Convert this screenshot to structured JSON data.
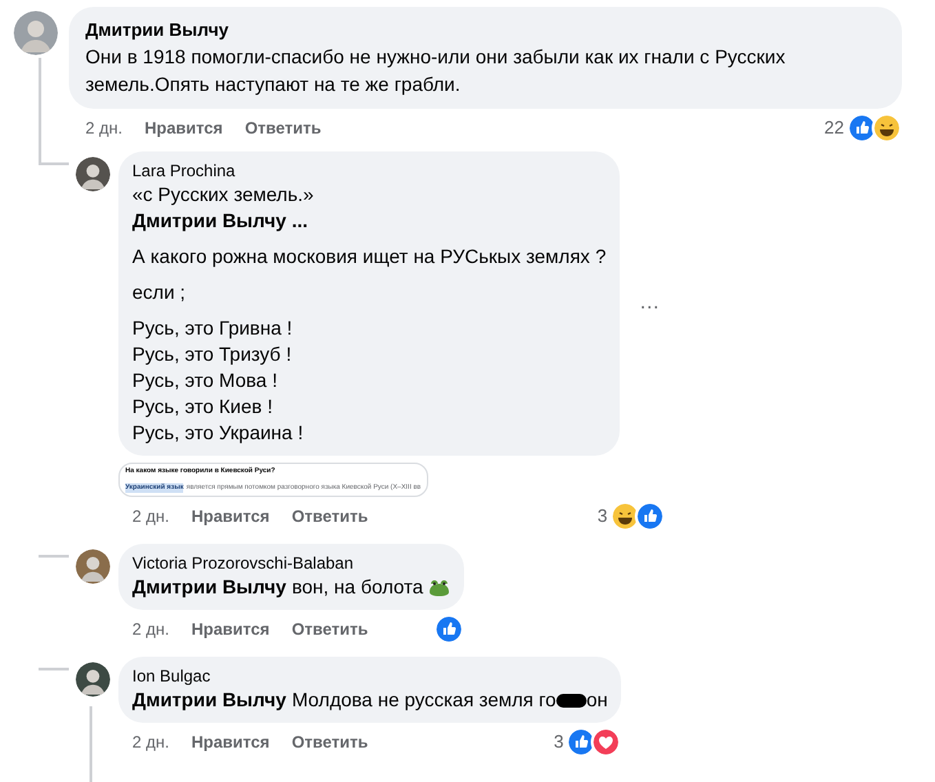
{
  "comment": {
    "author": "Дмитрии Вылчу",
    "text": "Они в 1918 помогли-спасибо не нужно-или они забыли как их гнали с Русских земель.Опять наступают на те же грабли.",
    "time": "2 дн.",
    "like_action": "Нравится",
    "reply_action": "Ответить",
    "reaction_count": "22",
    "reactions": [
      {
        "kind": "like"
      },
      {
        "kind": "haha"
      }
    ]
  },
  "replies": [
    {
      "author": "Lara Prochina",
      "blocks": [
        [
          {
            "text": "«с Русских земель.»",
            "bold": false
          },
          {
            "text": "Дмитрии Вылчу ...",
            "bold": true
          }
        ],
        [
          {
            "text": "А какого рожна московия ищет на РУСькых землях ?",
            "bold": false
          }
        ],
        [
          {
            "text": "если ;",
            "bold": false
          }
        ],
        [
          {
            "text": "Русь, это Гривна !",
            "bold": false
          },
          {
            "text": "Русь, это Тризуб !",
            "bold": false
          },
          {
            "text": "Русь, это Мова !",
            "bold": false
          },
          {
            "text": "Русь, это Киев !",
            "bold": false
          },
          {
            "text": "Русь, это Украина !",
            "bold": false
          }
        ]
      ],
      "more_button": "…",
      "preview": {
        "title": "На каком языке говорили в Киевской Руси?",
        "highlight": "Украинский язык",
        "snippet": "является прямым потомком разговорного языка Киевской Руси (X–XIII вв"
      },
      "time": "2 дн.",
      "like_action": "Нравится",
      "reply_action": "Ответить",
      "reaction_count": "3",
      "reactions": [
        {
          "kind": "haha"
        },
        {
          "kind": "like"
        }
      ]
    },
    {
      "author": "Victoria Prozorovschi-Balaban",
      "mention": "Дмитрии Вылчу",
      "text": "вон, на болота",
      "emoji": {
        "kind": "frog"
      },
      "time": "2 дн.",
      "like_action": "Нравится",
      "reply_action": "Ответить",
      "reactions": [
        {
          "kind": "like"
        }
      ]
    },
    {
      "author": "Ion Bulgac",
      "mention": "Дмитрии Вылчу",
      "text": "Молдова не русская земля го",
      "redacted": true,
      "text_after": "он",
      "time": "2 дн.",
      "like_action": "Нравится",
      "reply_action": "Ответить",
      "reaction_count": "3",
      "reactions": [
        {
          "kind": "like"
        },
        {
          "kind": "love"
        }
      ]
    }
  ]
}
